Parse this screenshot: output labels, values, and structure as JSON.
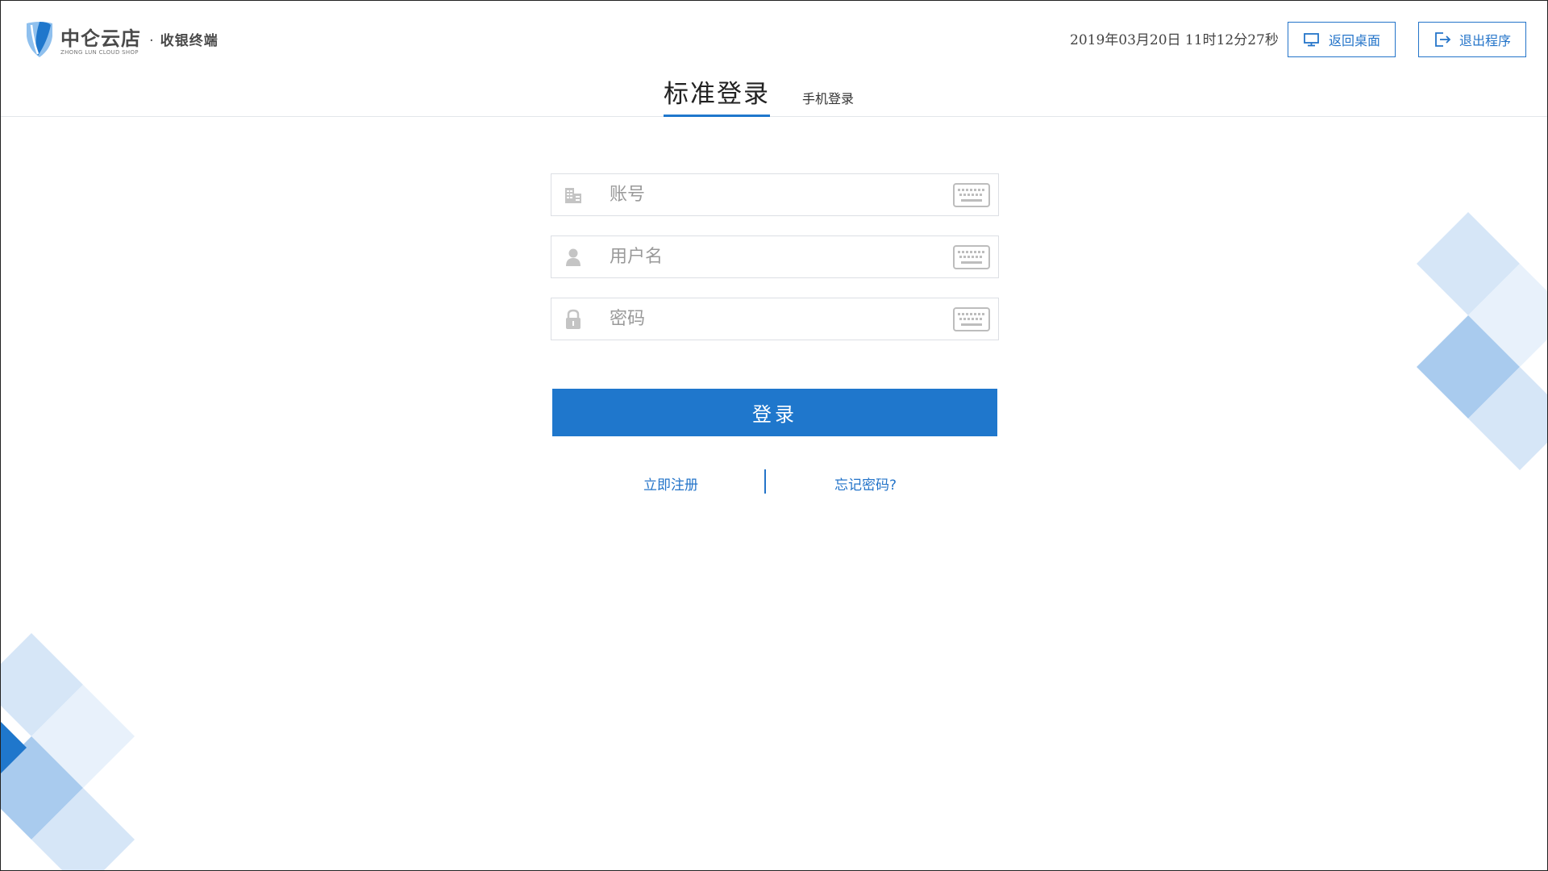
{
  "header": {
    "logo": {
      "name": "中仑云店",
      "separator": "·",
      "subtitle": "收银终端",
      "english": "ZHONG LUN CLOUD SHOP"
    },
    "datetime": "2019年03月20日 11时12分27秒",
    "buttons": {
      "desktop_label": "返回桌面",
      "exit_label": "退出程序"
    }
  },
  "tabs": {
    "standard_label": "标准登录",
    "phone_label": "手机登录",
    "active": "standard"
  },
  "form": {
    "account": {
      "value": "",
      "placeholder": "账号",
      "icon": "building-icon"
    },
    "username": {
      "value": "",
      "placeholder": "用户名",
      "icon": "user-icon"
    },
    "password": {
      "value": "",
      "placeholder": "密码",
      "icon": "lock-icon"
    },
    "keyboard_icon": "keyboard-icon",
    "submit_label": "登录"
  },
  "links": {
    "register_label": "立即注册",
    "forgot_label": "忘记密码?"
  },
  "colors": {
    "accent": "#1f77cc",
    "deco_light": "#d6e6f7",
    "deco_lighter": "#e8f1fb",
    "deco_mid": "#a9cbee",
    "deco_dark": "#1f77cc"
  }
}
